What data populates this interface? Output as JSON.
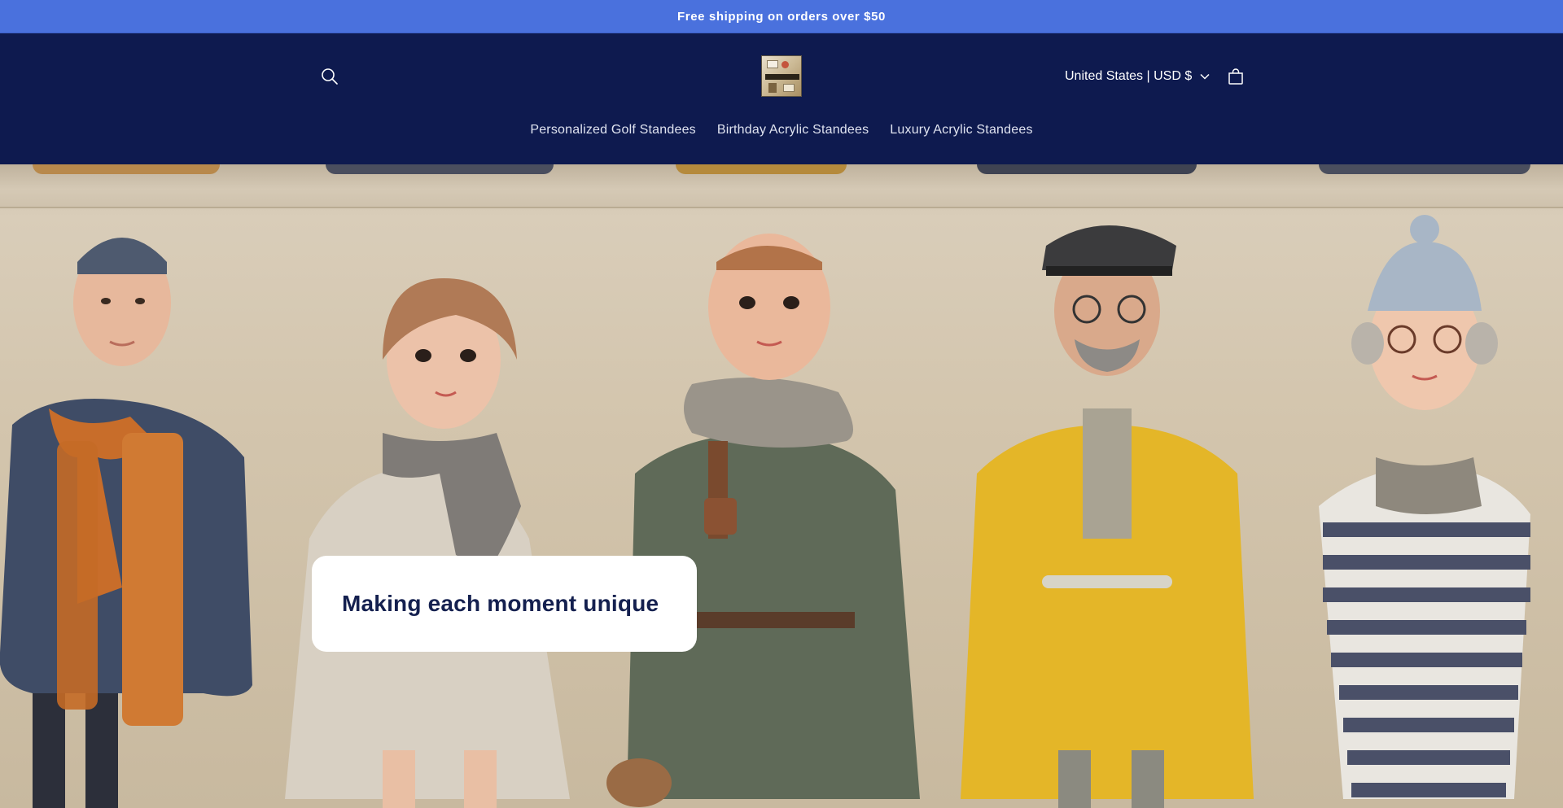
{
  "announcement": {
    "text": "Free shipping on orders over $50"
  },
  "header": {
    "search_icon": "search-icon",
    "logo_icon": "store-logo",
    "country_selector": {
      "label": "United States | USD $",
      "icon": "chevron-down-icon"
    },
    "cart_icon": "cart-icon"
  },
  "nav": {
    "items": [
      {
        "label": "Personalized Golf Standees"
      },
      {
        "label": "Birthday Acrylic Standees"
      },
      {
        "label": "Luxury Acrylic Standees"
      }
    ]
  },
  "hero": {
    "heading": "Making each moment unique",
    "image_subject": "row of five stylized figurines in winter coats and scarves"
  },
  "colors": {
    "announcement_bg": "#4a71dd",
    "header_bg": "#0e1a4f",
    "hero_heading": "#14204f",
    "card_bg": "#ffffff"
  }
}
